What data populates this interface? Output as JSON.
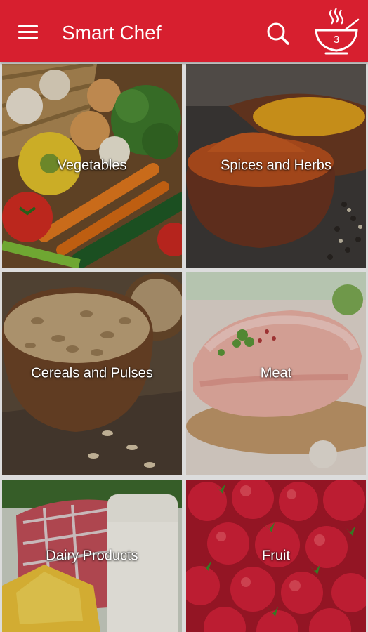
{
  "app": {
    "title": "Smart Chef"
  },
  "header": {
    "menu_icon": "hamburger-menu-icon",
    "search_icon": "search-icon",
    "cart_icon": "steaming-bowl-icon",
    "cart_count": "3",
    "background_color": "#d71f2f"
  },
  "categories": [
    {
      "label": "Vegetables",
      "image": "vegetables-photo"
    },
    {
      "label": "Spices and Herbs",
      "image": "spices-photo"
    },
    {
      "label": "Cereals and Pulses",
      "image": "cereals-photo"
    },
    {
      "label": "Meat",
      "image": "meat-photo"
    },
    {
      "label": "Dairy Products",
      "image": "dairy-photo"
    },
    {
      "label": "Fruit",
      "image": "fruit-photo"
    }
  ]
}
